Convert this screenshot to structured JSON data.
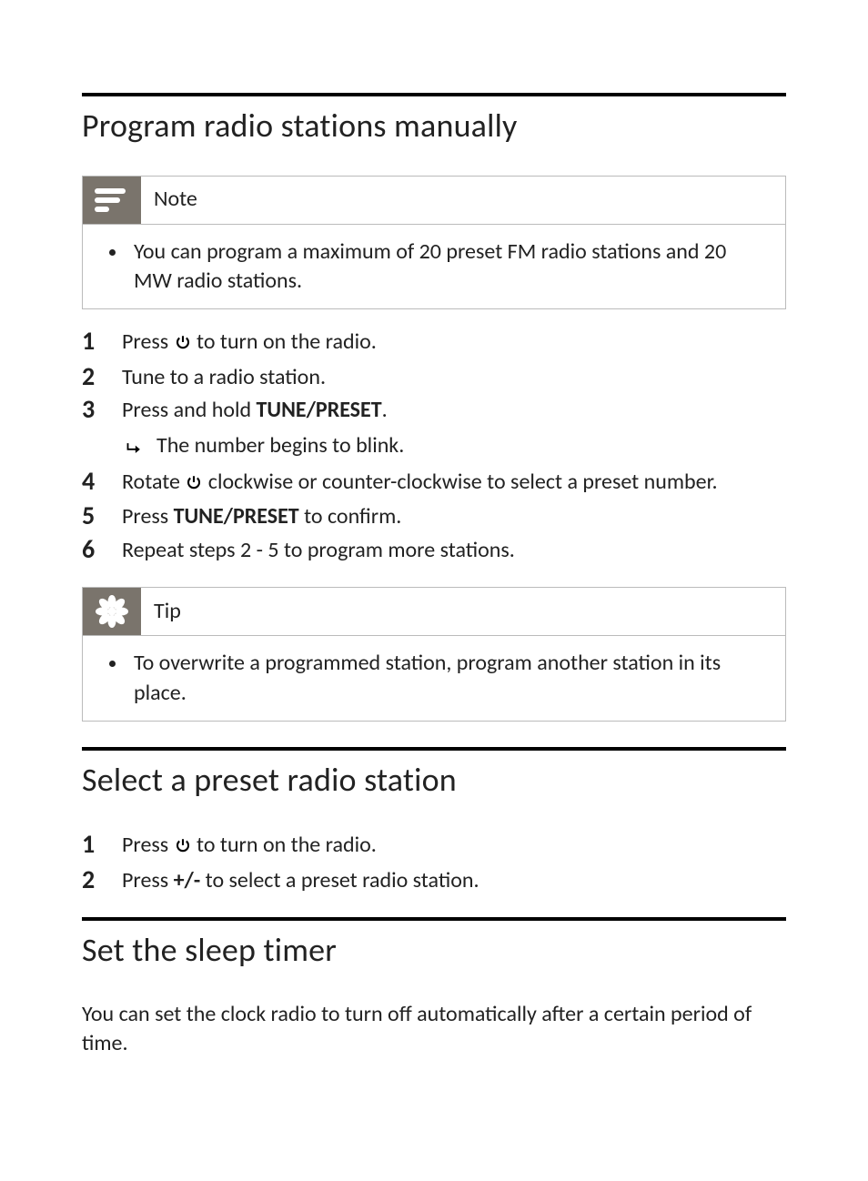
{
  "section1": {
    "heading": "Program radio stations manually",
    "note": {
      "label": "Note",
      "items": [
        "You can program a maximum of 20 preset FM radio stations and 20 MW radio stations."
      ]
    },
    "steps": {
      "s1_pre": "Press ",
      "s1_post": " to turn on the radio.",
      "s2": "Tune to a radio station.",
      "s3_pre": "Press and hold ",
      "s3_bold": "TUNE/PRESET",
      "s3_post": ".",
      "s3_sub": "The number begins to blink.",
      "s4_pre": "Rotate ",
      "s4_post": " clockwise or counter-clockwise to select a preset number.",
      "s5_pre": "Press ",
      "s5_bold": "TUNE/PRESET",
      "s5_post": " to confirm.",
      "s6": "Repeat steps 2 - 5 to program more stations."
    },
    "tip": {
      "label": "Tip",
      "items": [
        "To overwrite a programmed station, program another station in its place."
      ]
    }
  },
  "section2": {
    "heading": "Select a preset radio station",
    "steps": {
      "s1_pre": "Press ",
      "s1_post": " to turn on the radio.",
      "s2_pre": "Press ",
      "s2_bold": "+/-",
      "s2_post": " to select a preset radio station."
    }
  },
  "section3": {
    "heading": "Set the sleep timer",
    "intro": "You can set the clock radio to turn off automatically after a certain period of time."
  }
}
